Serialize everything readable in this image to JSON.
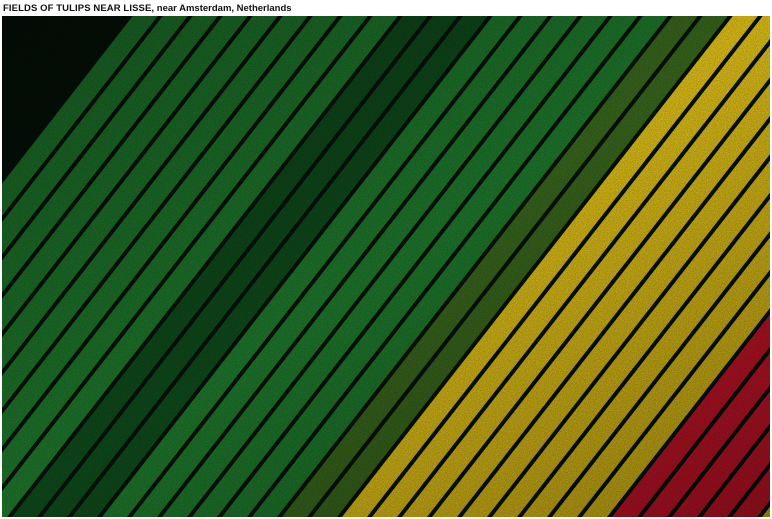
{
  "caption": {
    "title": "FIELDS OF TULIPS NEAR LISSE,",
    "location": "near Amsterdam, Netherlands"
  },
  "photo": {
    "subject": "aerial-tulip-fields",
    "colors": {
      "green": "#1f7a2c",
      "dark_green": "#0f4d1c",
      "olive": "#3a6a1e",
      "yellow": "#e7c619",
      "red": "#d5162a",
      "pink": "#e0216a",
      "crimson": "#b5123a",
      "furrow": "#06120a"
    }
  }
}
